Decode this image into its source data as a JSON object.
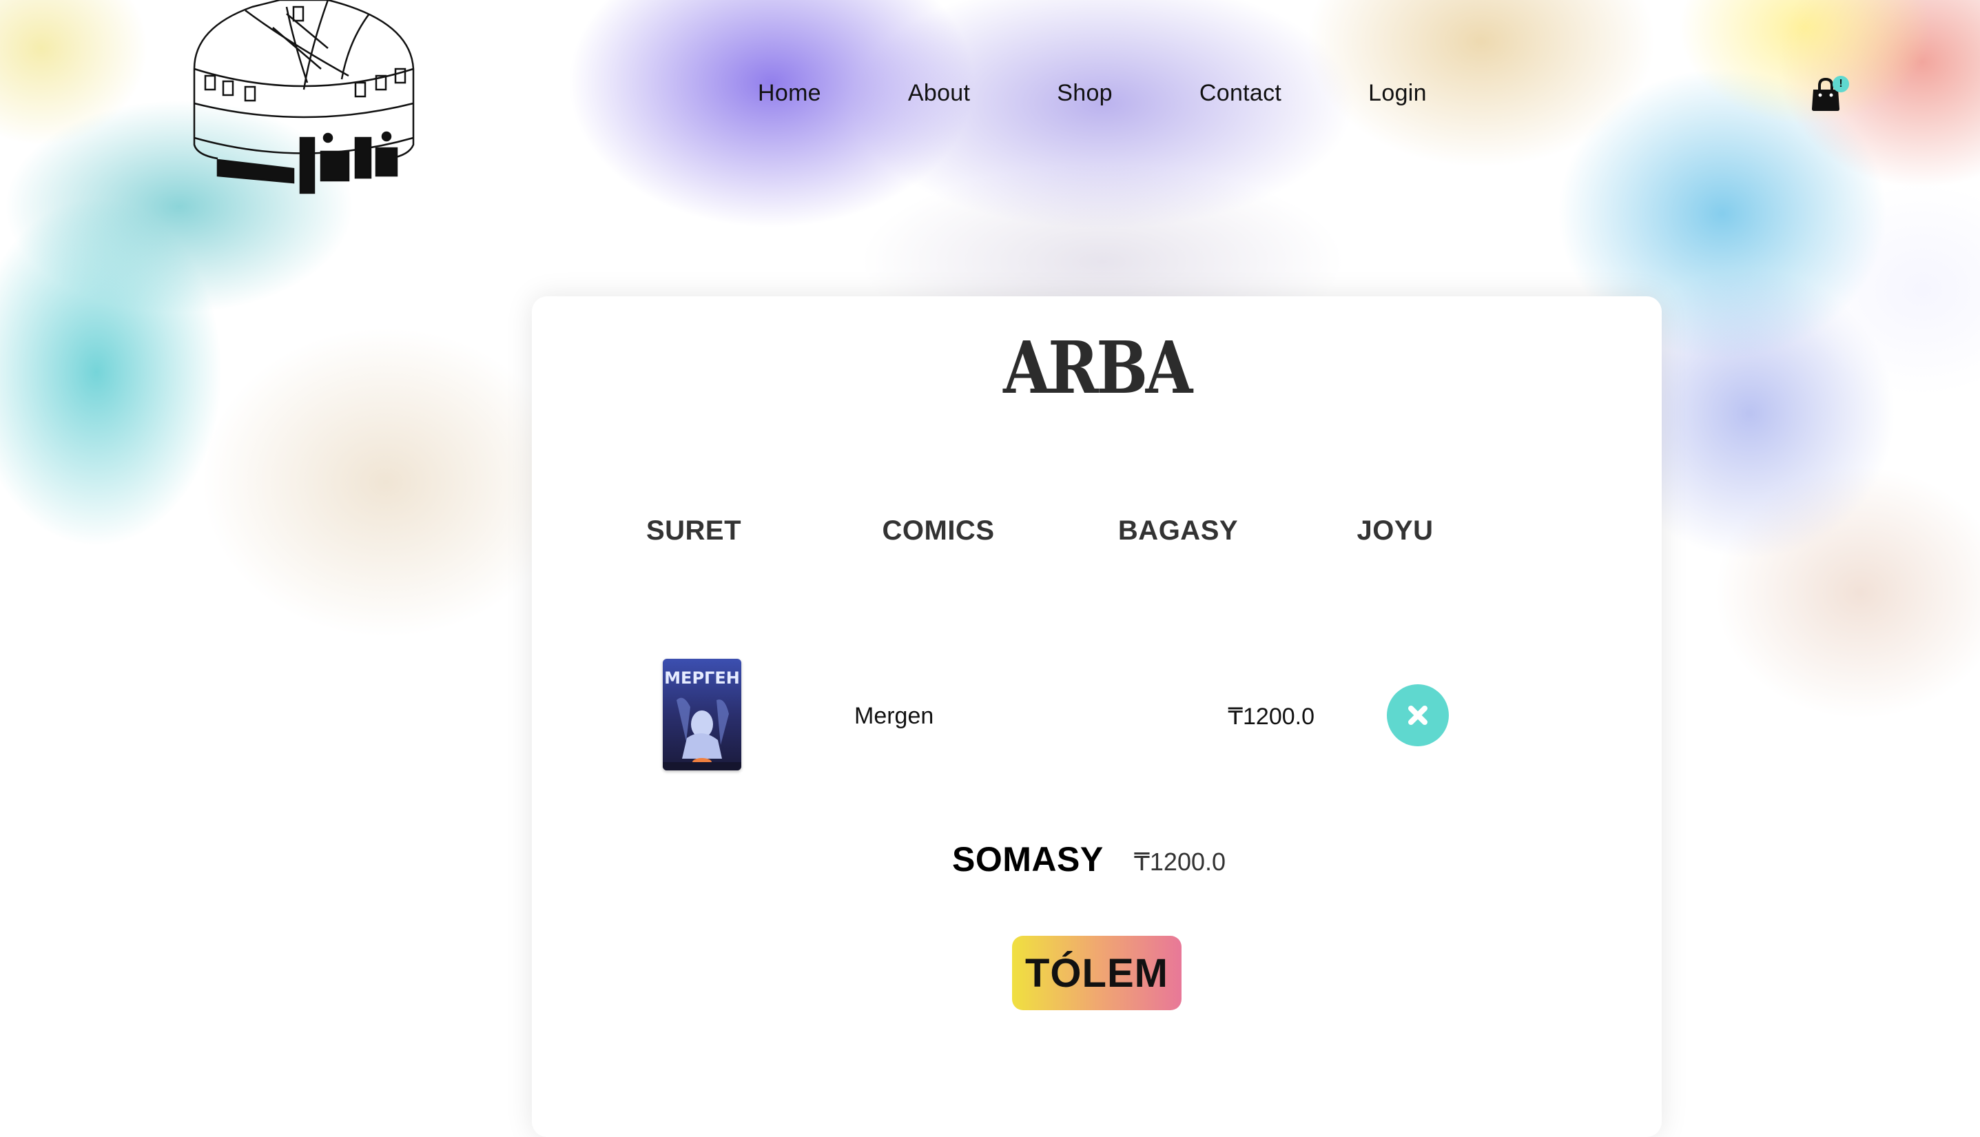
{
  "nav": {
    "items": [
      {
        "label": "Home"
      },
      {
        "label": "About"
      },
      {
        "label": "Shop"
      },
      {
        "label": "Contact"
      },
      {
        "label": "Login"
      }
    ]
  },
  "cart": {
    "badge": "!",
    "icon": "shopping-bag-icon"
  },
  "logo": {
    "icon": "yurt-logo-icon"
  },
  "page": {
    "title": "ARBA"
  },
  "table": {
    "headers": [
      "SURET",
      "COMICS",
      "BAGASY",
      "JOYU"
    ],
    "rows": [
      {
        "cover_title": "МЕРГЕН",
        "name": "Mergen",
        "price": "₸1200.0",
        "remove_icon": "close-icon"
      }
    ]
  },
  "total": {
    "label": "SOMASY",
    "value": "₸1200.0"
  },
  "checkout": {
    "label": "TÓLEM"
  },
  "colors": {
    "accent": "#5fd8cf",
    "pay_gradient": [
      "#f0e040",
      "#f0a870",
      "#e87898"
    ]
  }
}
